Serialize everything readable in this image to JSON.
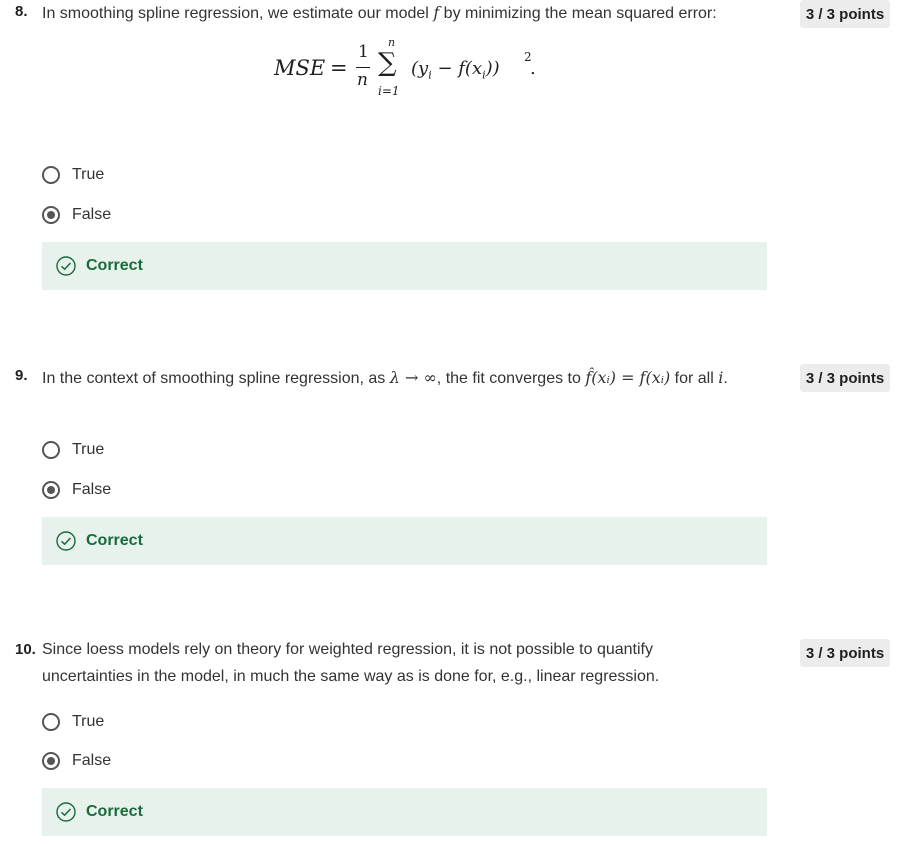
{
  "questions": [
    {
      "number": "8.",
      "text_before": "In smoothing spline regression, we estimate our model ",
      "text_var": "f",
      "text_after": " by minimizing the mean squared error:",
      "formula": {
        "lhs": "MSE",
        "eq": "=",
        "frac_num": "1",
        "frac_den": "n",
        "sum_top": "n",
        "sum_sym": "∑",
        "sum_bottom": "i=1",
        "body": "(y",
        "body_sub": "i",
        "body_mid": " − f(x",
        "body_sub2": "i",
        "body_end": "))",
        "power": "2",
        "dot": "."
      },
      "points": "3 / 3 points",
      "options": [
        "True",
        "False"
      ],
      "selected": "False",
      "feedback": "Correct"
    },
    {
      "number": "9.",
      "text_before": "In the context of smoothing spline regression, as ",
      "text_math1": "λ → ∞",
      "text_mid": ", the fit converges to ",
      "text_math2": "f̂(xᵢ) = f(xᵢ)",
      "text_after": " for all ",
      "text_math3": "i",
      "text_end": ".",
      "points": "3 / 3 points",
      "options": [
        "True",
        "False"
      ],
      "selected": "False",
      "feedback": "Correct"
    },
    {
      "number": "10.",
      "text": "Since loess models rely on theory for weighted regression, it is not possible to quantify uncertainties in the model, in much the same way as is done for, e.g., linear regression.",
      "points": "3 / 3 points",
      "options": [
        "True",
        "False"
      ],
      "selected": "False",
      "feedback": "Correct"
    }
  ],
  "colors": {
    "correct_bg": "#e7f2ec",
    "correct_text": "#1a6b3c",
    "points_bg": "#ececec"
  }
}
